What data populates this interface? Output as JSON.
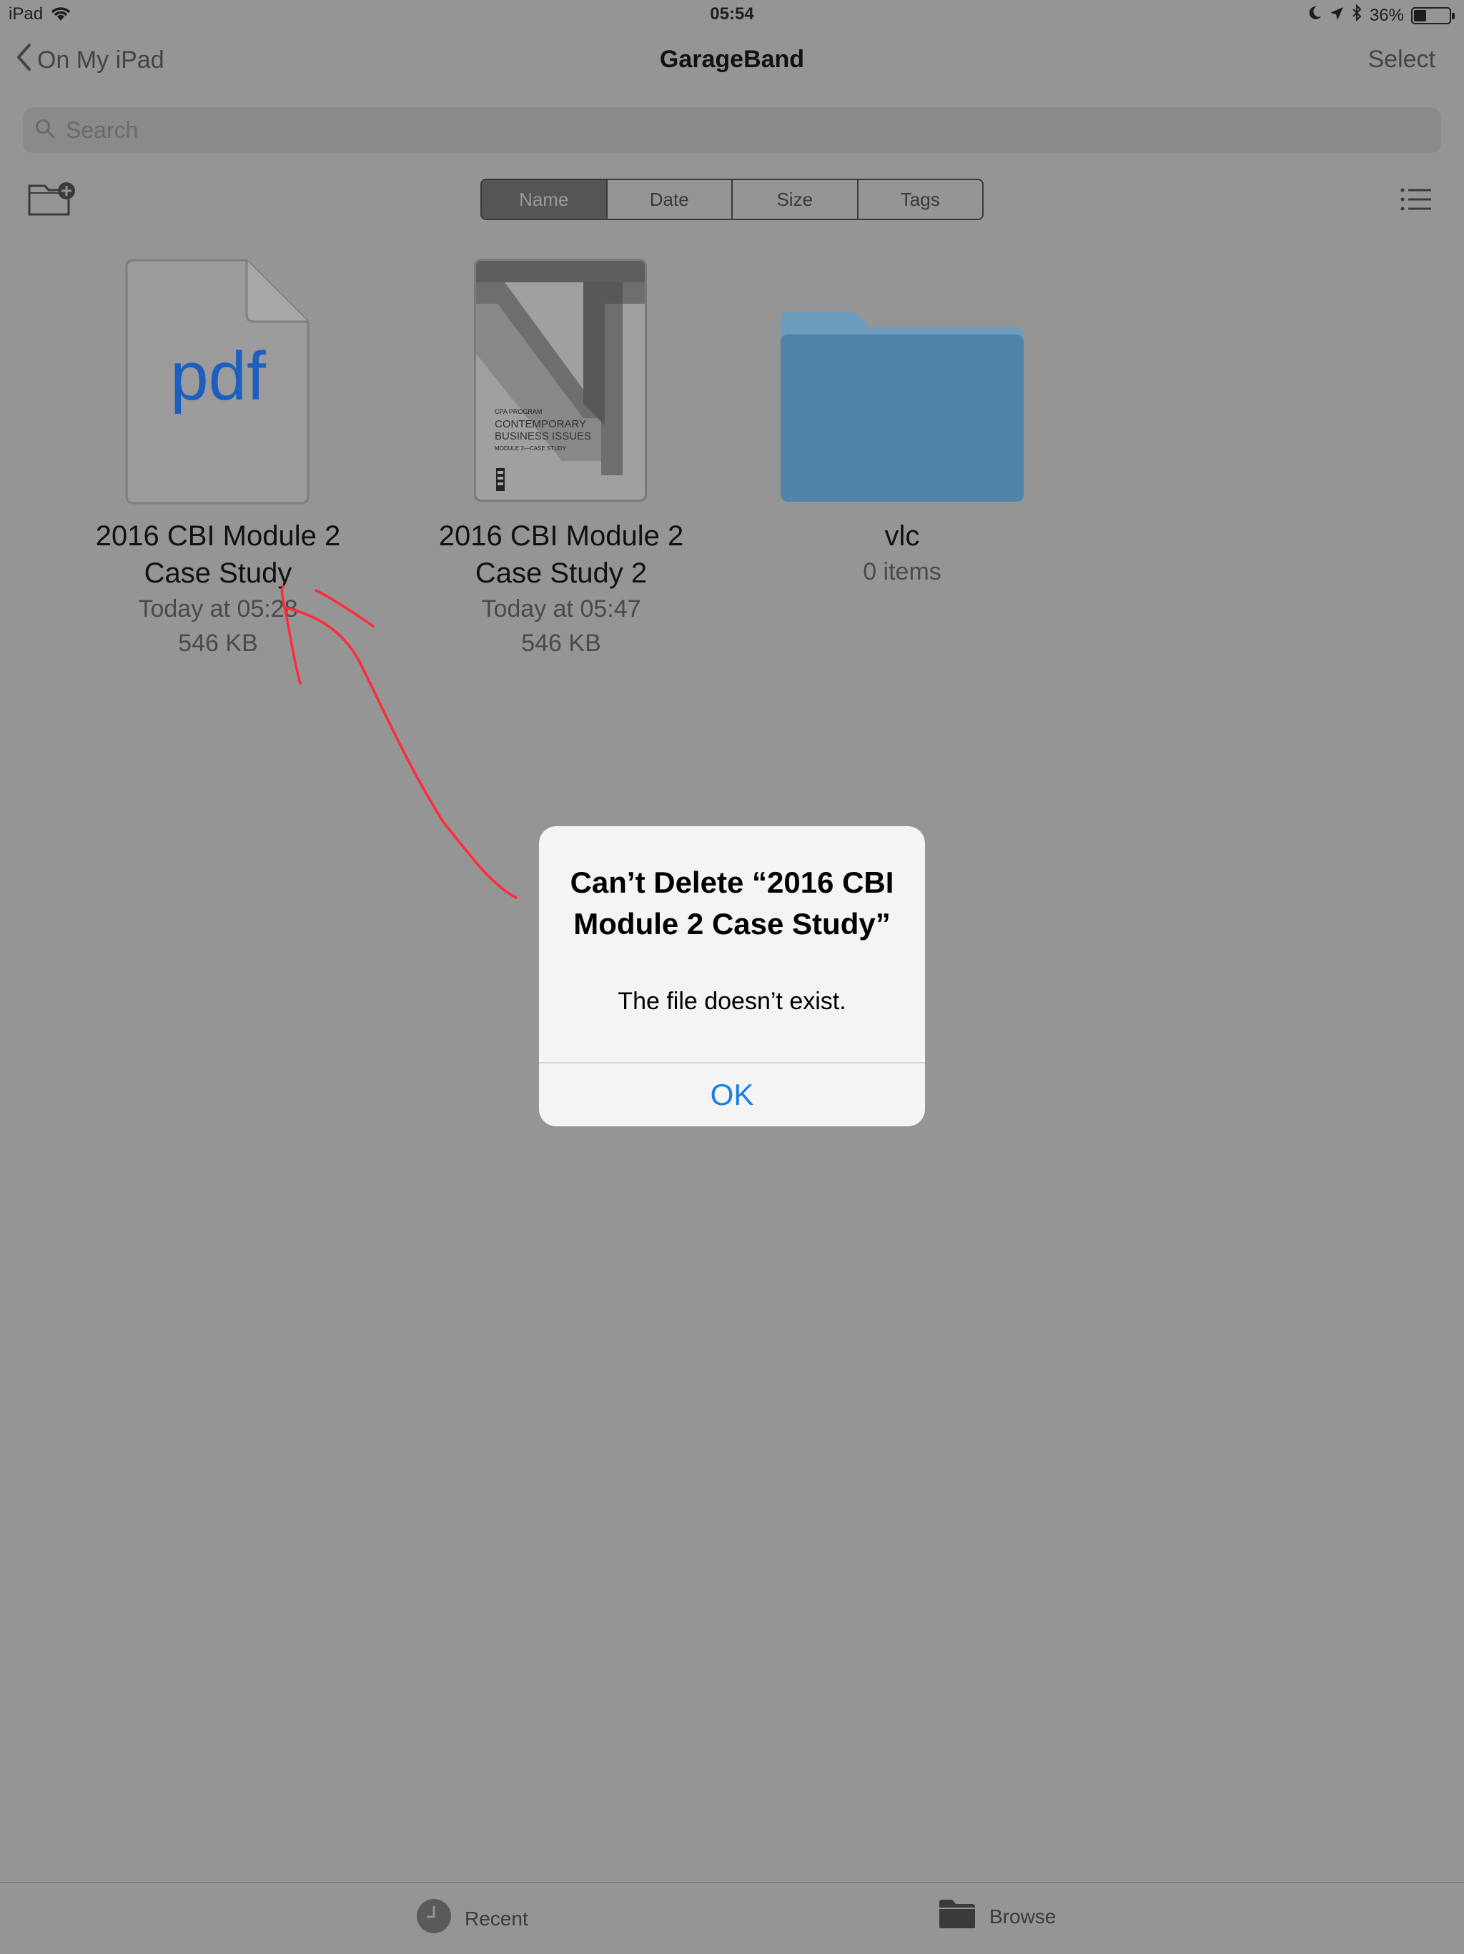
{
  "status_bar": {
    "device": "iPad",
    "time": "05:54",
    "battery": "36%",
    "battery_level": 0.36
  },
  "nav": {
    "back_label": "On My iPad",
    "title": "GarageBand",
    "select_label": "Select"
  },
  "search": {
    "placeholder": "Search"
  },
  "sort": {
    "options": [
      "Name",
      "Date",
      "Size",
      "Tags"
    ],
    "active": "Name"
  },
  "items": [
    {
      "name_line1": "2016 CBI Module 2",
      "name_line2": "Case Study",
      "date": "Today at 05:28",
      "size": "546 KB",
      "thumb_label": "pdf"
    },
    {
      "name_line1": "2016 CBI Module 2",
      "name_line2": "Case Study 2",
      "date": "Today at 05:47",
      "size": "546 KB",
      "cover": {
        "program": "CPA PROGRAM",
        "line1": "CONTEMPORARY",
        "line2": "BUSINESS ISSUES",
        "subtitle": "MODULE 2—CASE STUDY"
      }
    },
    {
      "name": "vlc",
      "count": "0 items"
    }
  ],
  "alert": {
    "title": "Can’t Delete “2016 CBI Module 2 Case Study”",
    "message": "The file doesn’t exist.",
    "ok_label": "OK"
  },
  "tabs": {
    "recent": "Recent",
    "browse": "Browse"
  },
  "colors": {
    "accent": "#1a7ee0",
    "pdf_text": "#1d5fbf",
    "folder": "#5b93b8",
    "annotation": "#ff2b3a"
  }
}
